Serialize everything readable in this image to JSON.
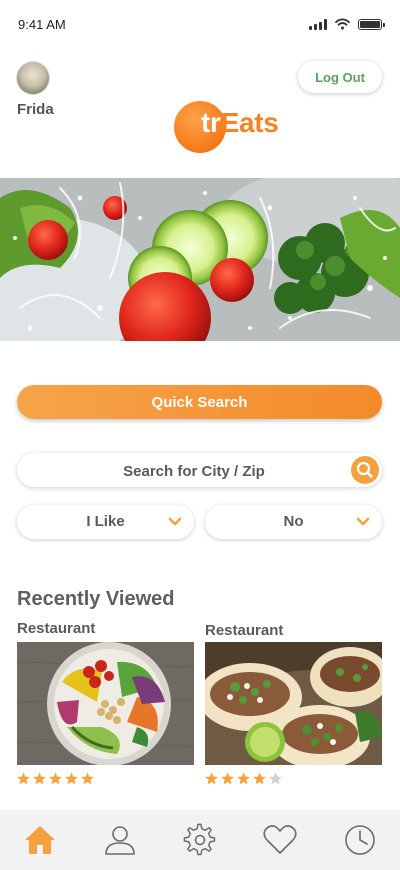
{
  "status_bar": {
    "time": "9:41 AM"
  },
  "header": {
    "user_name": "Frida",
    "logout_label": "Log Out",
    "logo": {
      "part1": "tr",
      "part2": "Eats"
    }
  },
  "actions": {
    "quick_search_label": "Quick Search",
    "search_placeholder": "Search for City / Zip",
    "filter_like": "I Like",
    "filter_no": "No"
  },
  "recently_viewed": {
    "title": "Recently Viewed",
    "items": [
      {
        "label": "Restaurant",
        "rating": 5,
        "max_rating": 5
      },
      {
        "label": "Restaurant",
        "rating": 4,
        "max_rating": 5
      }
    ]
  },
  "bottom_nav": {
    "icons": [
      "home-icon",
      "profile-icon",
      "settings-icon",
      "favorites-icon",
      "history-icon"
    ],
    "active": "home-icon"
  },
  "colors": {
    "accent": "#f58223",
    "active_nav": "#f7a13e",
    "inactive_nav": "#6a6a6a",
    "logout_text": "#5aa062",
    "star_empty": "#cfcfcf"
  }
}
